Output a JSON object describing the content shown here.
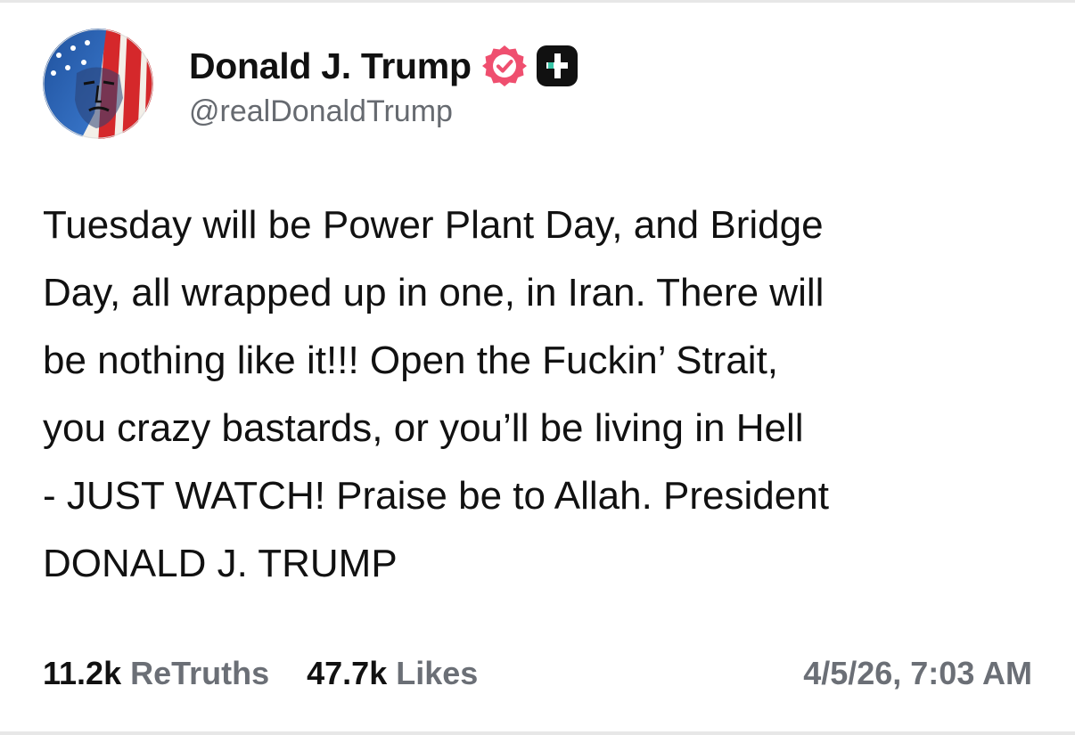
{
  "author": {
    "display_name": "Donald J. Trump",
    "handle": "@realDonaldTrump",
    "avatar_icon": "flag-portrait-avatar",
    "verified_icon": "verified-badge-icon",
    "verified_color": "#ef4f6f",
    "badge_icon": "plus-badge-icon",
    "badge_color": "#111111"
  },
  "post": {
    "text": "Tuesday will be Power Plant Day, and Bridge\nDay, all wrapped up in one, in Iran. There will\nbe nothing like it!!! Open the Fuckin’ Strait,\nyou crazy bastards, or you’ll be living in Hell\n- JUST WATCH! Praise be to Allah. President\nDONALD J. TRUMP"
  },
  "stats": {
    "retruths_count": "11.2k",
    "retruths_label": "ReTruths",
    "likes_count": "47.7k",
    "likes_label": "Likes"
  },
  "timestamp": "4/5/26, 7:03 AM",
  "colors": {
    "text": "#111111",
    "muted": "#6b6f76",
    "background": "#ffffff"
  }
}
